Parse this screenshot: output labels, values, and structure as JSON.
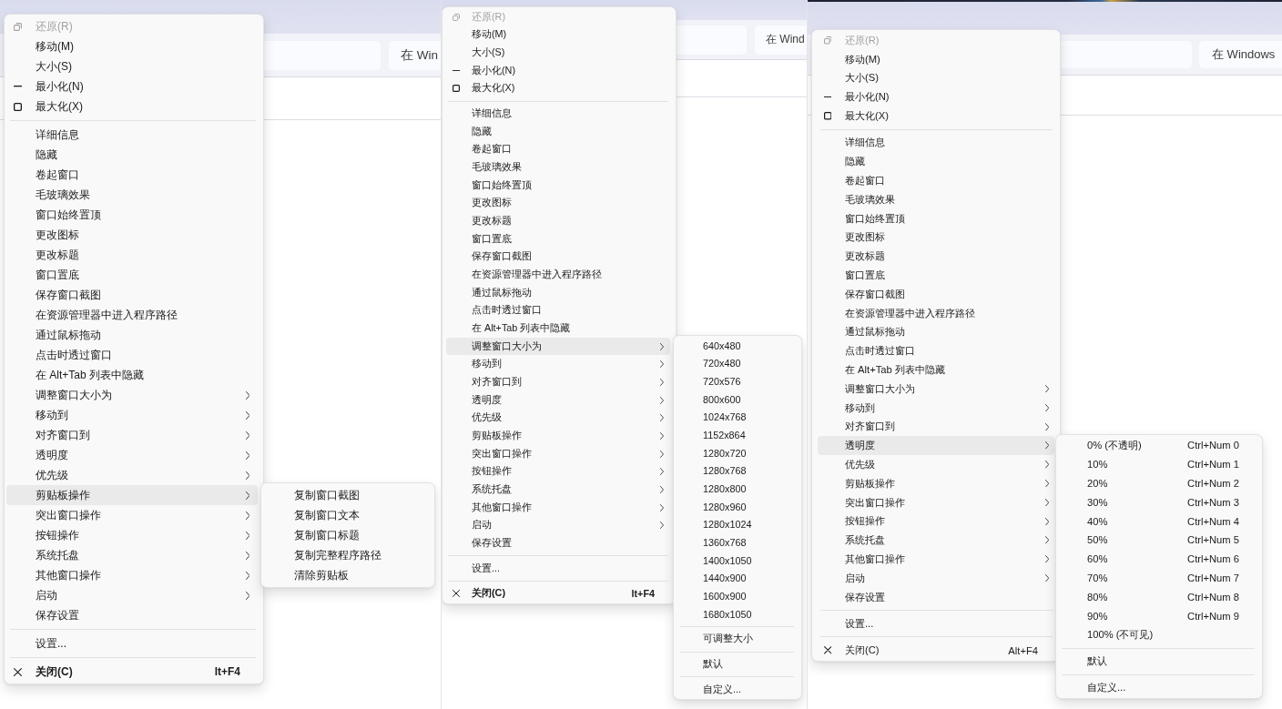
{
  "panels": [
    {
      "background_window": {
        "toolbar_button": "在 Win"
      },
      "menu": {
        "sections": [
          {
            "items": [
              {
                "kind": "restore",
                "label": "还原(R)",
                "disabled": true
              },
              {
                "kind": "plain",
                "label": "移动(M)",
                "disabled": false
              },
              {
                "kind": "plain",
                "label": "大小(S)",
                "disabled": false
              },
              {
                "kind": "minimize",
                "label": "最小化(N)",
                "disabled": false
              },
              {
                "kind": "maximize",
                "label": "最大化(X)",
                "disabled": false
              }
            ]
          },
          {
            "items": [
              {
                "kind": "plain",
                "label": "详细信息",
                "highlighted": false
              },
              {
                "kind": "plain",
                "label": "隐藏",
                "highlighted": false
              },
              {
                "kind": "plain",
                "label": "卷起窗口",
                "highlighted": false
              },
              {
                "kind": "plain",
                "label": "毛玻璃效果",
                "highlighted": false
              },
              {
                "kind": "plain",
                "label": "窗口始终置顶",
                "highlighted": false
              },
              {
                "kind": "plain",
                "label": "更改图标",
                "highlighted": false
              },
              {
                "kind": "plain",
                "label": "更改标题",
                "highlighted": false
              },
              {
                "kind": "plain",
                "label": "窗口置底",
                "highlighted": false
              },
              {
                "kind": "plain",
                "label": "保存窗口截图",
                "highlighted": false
              },
              {
                "kind": "plain",
                "label": "在资源管理器中进入程序路径",
                "highlighted": false
              },
              {
                "kind": "plain",
                "label": "通过鼠标拖动",
                "highlighted": false
              },
              {
                "kind": "plain",
                "label": "点击时透过窗口",
                "highlighted": false
              },
              {
                "kind": "plain",
                "label": "在 Alt+Tab 列表中隐藏",
                "highlighted": false
              },
              {
                "kind": "submenu",
                "label": "调整窗口大小为",
                "highlighted": false
              },
              {
                "kind": "submenu",
                "label": "移动到",
                "highlighted": false
              },
              {
                "kind": "submenu",
                "label": "对齐窗口到",
                "highlighted": false
              },
              {
                "kind": "submenu",
                "label": "透明度",
                "highlighted": false
              },
              {
                "kind": "submenu",
                "label": "优先级",
                "highlighted": false
              },
              {
                "kind": "submenu",
                "label": "剪贴板操作",
                "highlighted": true
              },
              {
                "kind": "submenu",
                "label": "突出窗口操作",
                "highlighted": false
              },
              {
                "kind": "submenu",
                "label": "按钮操作",
                "highlighted": false
              },
              {
                "kind": "submenu",
                "label": "系统托盘",
                "highlighted": false
              },
              {
                "kind": "submenu",
                "label": "其他窗口操作",
                "highlighted": false
              },
              {
                "kind": "submenu",
                "label": "启动",
                "highlighted": false
              },
              {
                "kind": "plain",
                "label": "保存设置",
                "highlighted": false
              }
            ]
          },
          {
            "items": [
              {
                "kind": "plain",
                "label": "设置..."
              }
            ]
          },
          {
            "items": [
              {
                "kind": "close",
                "label": "关闭(C)",
                "shortcut": "lt+F4",
                "default": true
              }
            ]
          }
        ]
      },
      "submenu": {
        "sections": [
          {
            "items": [
              {
                "label": "复制窗口截图"
              },
              {
                "label": "复制窗口文本"
              },
              {
                "label": "复制窗口标题"
              },
              {
                "label": "复制完整程序路径"
              },
              {
                "label": "清除剪贴板"
              }
            ]
          }
        ]
      }
    },
    {
      "background_window": {
        "toolbar_button": "在 Wind"
      },
      "menu": {
        "sections": [
          {
            "items": [
              {
                "kind": "restore",
                "label": "还原(R)",
                "disabled": true
              },
              {
                "kind": "plain",
                "label": "移动(M)",
                "disabled": false
              },
              {
                "kind": "plain",
                "label": "大小(S)",
                "disabled": false
              },
              {
                "kind": "minimize",
                "label": "最小化(N)",
                "disabled": false
              },
              {
                "kind": "maximize",
                "label": "最大化(X)",
                "disabled": false
              }
            ]
          },
          {
            "items": [
              {
                "kind": "plain",
                "label": "详细信息",
                "highlighted": false
              },
              {
                "kind": "plain",
                "label": "隐藏",
                "highlighted": false
              },
              {
                "kind": "plain",
                "label": "卷起窗口",
                "highlighted": false
              },
              {
                "kind": "plain",
                "label": "毛玻璃效果",
                "highlighted": false
              },
              {
                "kind": "plain",
                "label": "窗口始终置顶",
                "highlighted": false
              },
              {
                "kind": "plain",
                "label": "更改图标",
                "highlighted": false
              },
              {
                "kind": "plain",
                "label": "更改标题",
                "highlighted": false
              },
              {
                "kind": "plain",
                "label": "窗口置底",
                "highlighted": false
              },
              {
                "kind": "plain",
                "label": "保存窗口截图",
                "highlighted": false
              },
              {
                "kind": "plain",
                "label": "在资源管理器中进入程序路径",
                "highlighted": false
              },
              {
                "kind": "plain",
                "label": "通过鼠标拖动",
                "highlighted": false
              },
              {
                "kind": "plain",
                "label": "点击时透过窗口",
                "highlighted": false
              },
              {
                "kind": "plain",
                "label": "在 Alt+Tab 列表中隐藏",
                "highlighted": false
              },
              {
                "kind": "submenu",
                "label": "调整窗口大小为",
                "highlighted": true
              },
              {
                "kind": "submenu",
                "label": "移动到",
                "highlighted": false
              },
              {
                "kind": "submenu",
                "label": "对齐窗口到",
                "highlighted": false
              },
              {
                "kind": "submenu",
                "label": "透明度",
                "highlighted": false
              },
              {
                "kind": "submenu",
                "label": "优先级",
                "highlighted": false
              },
              {
                "kind": "submenu",
                "label": "剪贴板操作",
                "highlighted": false
              },
              {
                "kind": "submenu",
                "label": "突出窗口操作",
                "highlighted": false
              },
              {
                "kind": "submenu",
                "label": "按钮操作",
                "highlighted": false
              },
              {
                "kind": "submenu",
                "label": "系统托盘",
                "highlighted": false
              },
              {
                "kind": "submenu",
                "label": "其他窗口操作",
                "highlighted": false
              },
              {
                "kind": "submenu",
                "label": "启动",
                "highlighted": false
              },
              {
                "kind": "plain",
                "label": "保存设置",
                "highlighted": false
              }
            ]
          },
          {
            "items": [
              {
                "kind": "plain",
                "label": "设置..."
              }
            ]
          },
          {
            "items": [
              {
                "kind": "close",
                "label": "关闭(C)",
                "shortcut": "lt+F4",
                "default": true
              }
            ]
          }
        ]
      },
      "submenu": {
        "sections": [
          {
            "items": [
              {
                "label": "640x480"
              },
              {
                "label": "720x480"
              },
              {
                "label": "720x576"
              },
              {
                "label": "800x600"
              },
              {
                "label": "1024x768"
              },
              {
                "label": "1152x864"
              },
              {
                "label": "1280x720"
              },
              {
                "label": "1280x768"
              },
              {
                "label": "1280x800"
              },
              {
                "label": "1280x960"
              },
              {
                "label": "1280x1024"
              },
              {
                "label": "1360x768"
              },
              {
                "label": "1400x1050"
              },
              {
                "label": "1440x900"
              },
              {
                "label": "1600x900"
              },
              {
                "label": "1680x1050"
              }
            ]
          },
          {
            "items": [
              {
                "label": "可调整大小"
              }
            ]
          },
          {
            "items": [
              {
                "label": "默认"
              }
            ]
          },
          {
            "items": [
              {
                "label": "自定义..."
              }
            ]
          }
        ]
      }
    },
    {
      "background_window": {
        "toolbar_button": "在 Windows"
      },
      "menu": {
        "sections": [
          {
            "items": [
              {
                "kind": "restore",
                "label": "还原(R)",
                "disabled": true
              },
              {
                "kind": "plain",
                "label": "移动(M)",
                "disabled": false
              },
              {
                "kind": "plain",
                "label": "大小(S)",
                "disabled": false
              },
              {
                "kind": "minimize",
                "label": "最小化(N)",
                "disabled": false
              },
              {
                "kind": "maximize",
                "label": "最大化(X)",
                "disabled": false
              }
            ]
          },
          {
            "items": [
              {
                "kind": "plain",
                "label": "详细信息",
                "highlighted": false
              },
              {
                "kind": "plain",
                "label": "隐藏",
                "highlighted": false
              },
              {
                "kind": "plain",
                "label": "卷起窗口",
                "highlighted": false
              },
              {
                "kind": "plain",
                "label": "毛玻璃效果",
                "highlighted": false
              },
              {
                "kind": "plain",
                "label": "窗口始终置顶",
                "highlighted": false
              },
              {
                "kind": "plain",
                "label": "更改图标",
                "highlighted": false
              },
              {
                "kind": "plain",
                "label": "更改标题",
                "highlighted": false
              },
              {
                "kind": "plain",
                "label": "窗口置底",
                "highlighted": false
              },
              {
                "kind": "plain",
                "label": "保存窗口截图",
                "highlighted": false
              },
              {
                "kind": "plain",
                "label": "在资源管理器中进入程序路径",
                "highlighted": false
              },
              {
                "kind": "plain",
                "label": "通过鼠标拖动",
                "highlighted": false
              },
              {
                "kind": "plain",
                "label": "点击时透过窗口",
                "highlighted": false
              },
              {
                "kind": "plain",
                "label": "在 Alt+Tab 列表中隐藏",
                "highlighted": false
              },
              {
                "kind": "submenu",
                "label": "调整窗口大小为",
                "highlighted": false
              },
              {
                "kind": "submenu",
                "label": "移动到",
                "highlighted": false
              },
              {
                "kind": "submenu",
                "label": "对齐窗口到",
                "highlighted": false
              },
              {
                "kind": "submenu",
                "label": "透明度",
                "highlighted": true
              },
              {
                "kind": "submenu",
                "label": "优先级",
                "highlighted": false
              },
              {
                "kind": "submenu",
                "label": "剪贴板操作",
                "highlighted": false
              },
              {
                "kind": "submenu",
                "label": "突出窗口操作",
                "highlighted": false
              },
              {
                "kind": "submenu",
                "label": "按钮操作",
                "highlighted": false
              },
              {
                "kind": "submenu",
                "label": "系统托盘",
                "highlighted": false
              },
              {
                "kind": "submenu",
                "label": "其他窗口操作",
                "highlighted": false
              },
              {
                "kind": "submenu",
                "label": "启动",
                "highlighted": false
              },
              {
                "kind": "plain",
                "label": "保存设置",
                "highlighted": false
              }
            ]
          },
          {
            "items": [
              {
                "kind": "plain",
                "label": "设置..."
              }
            ]
          },
          {
            "items": [
              {
                "kind": "close",
                "label": "关闭(C)",
                "shortcut": "Alt+F4",
                "default": false
              }
            ]
          }
        ]
      },
      "submenu": {
        "sections": [
          {
            "items": [
              {
                "label": "0% (不透明)",
                "shortcut": "Ctrl+Num 0"
              },
              {
                "label": "10%",
                "shortcut": "Ctrl+Num 1"
              },
              {
                "label": "20%",
                "shortcut": "Ctrl+Num 2"
              },
              {
                "label": "30%",
                "shortcut": "Ctrl+Num 3"
              },
              {
                "label": "40%",
                "shortcut": "Ctrl+Num 4"
              },
              {
                "label": "50%",
                "shortcut": "Ctrl+Num 5"
              },
              {
                "label": "60%",
                "shortcut": "Ctrl+Num 6"
              },
              {
                "label": "70%",
                "shortcut": "Ctrl+Num 7"
              },
              {
                "label": "80%",
                "shortcut": "Ctrl+Num 8"
              },
              {
                "label": "90%",
                "shortcut": "Ctrl+Num 9"
              },
              {
                "label": "100% (不可见)"
              }
            ]
          },
          {
            "items": [
              {
                "label": "默认"
              }
            ]
          },
          {
            "items": [
              {
                "label": "自定义..."
              }
            ]
          }
        ]
      }
    }
  ]
}
